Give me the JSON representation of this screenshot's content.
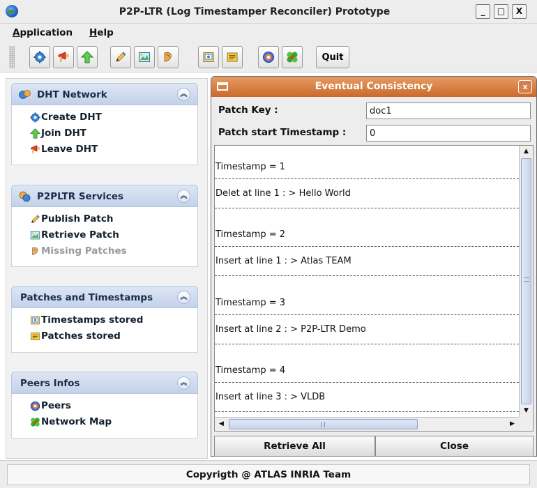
{
  "window": {
    "title": "P2P-LTR (Log Timestamper Reconciler) Prototype",
    "minimize": "_",
    "maximize": "□",
    "close": "X"
  },
  "menu": {
    "application": {
      "underline": "A",
      "rest": "pplication"
    },
    "help": {
      "underline": "H",
      "rest": "elp"
    }
  },
  "toolbar": {
    "buttons": [
      {
        "icon": "gear-network-icon"
      },
      {
        "icon": "leave-icon"
      },
      {
        "icon": "join-arrow-icon"
      },
      {
        "icon": "pencil-icon"
      },
      {
        "icon": "retrieve-icon"
      },
      {
        "icon": "missing-patches-icon"
      },
      {
        "icon": "timestamps-icon"
      },
      {
        "icon": "patches-icon"
      },
      {
        "icon": "peers-icon"
      },
      {
        "icon": "network-map-icon"
      }
    ],
    "quit_label": "Quit"
  },
  "sidebar": {
    "sections": [
      {
        "title": "DHT Network",
        "items": [
          {
            "label": "Create DHT",
            "icon": "gear-network-icon"
          },
          {
            "label": "Join DHT",
            "icon": "join-arrow-icon"
          },
          {
            "label": "Leave DHT",
            "icon": "leave-icon"
          }
        ]
      },
      {
        "title": "P2PLTR Services",
        "items": [
          {
            "label": "Publish Patch",
            "icon": "pencil-icon"
          },
          {
            "label": "Retrieve Patch",
            "icon": "retrieve-icon"
          },
          {
            "label": "Missing Patches",
            "icon": "missing-patches-icon",
            "disabled": true
          }
        ]
      },
      {
        "title": "Patches and Timestamps",
        "items": [
          {
            "label": "Timestamps stored",
            "icon": "timestamps-icon"
          },
          {
            "label": "Patches stored",
            "icon": "patches-icon"
          }
        ]
      },
      {
        "title": "Peers Infos",
        "items": [
          {
            "label": "Peers",
            "icon": "peers-icon"
          },
          {
            "label": "Network Map",
            "icon": "network-map-icon"
          }
        ]
      }
    ],
    "collapse_glyph": "︽"
  },
  "dialog": {
    "title": "Eventual Consistency",
    "close": "x",
    "patch_key_label": "Patch Key :",
    "patch_key_value": "doc1",
    "patch_ts_label": "Patch start Timestamp :",
    "patch_ts_value": "0",
    "log_entries": [
      {
        "timestamp": "Timestamp = 1",
        "action": "Delet at line 1 : > Hello World"
      },
      {
        "timestamp": "Timestamp = 2",
        "action": "Insert at line 1 : > Atlas TEAM"
      },
      {
        "timestamp": "Timestamp = 3",
        "action": "Insert at line 2 : > P2P-LTR Demo"
      },
      {
        "timestamp": "Timestamp = 4",
        "action": "Insert at line 3 : > VLDB"
      }
    ],
    "retrieve_all_label": "Retrieve All",
    "close_label": "Close",
    "scroll_up": "▲",
    "scroll_down": "▼",
    "scroll_left": "◀",
    "scroll_right": "▶"
  },
  "footer": {
    "text": "Copyrigth @ ATLAS INRIA Team"
  }
}
